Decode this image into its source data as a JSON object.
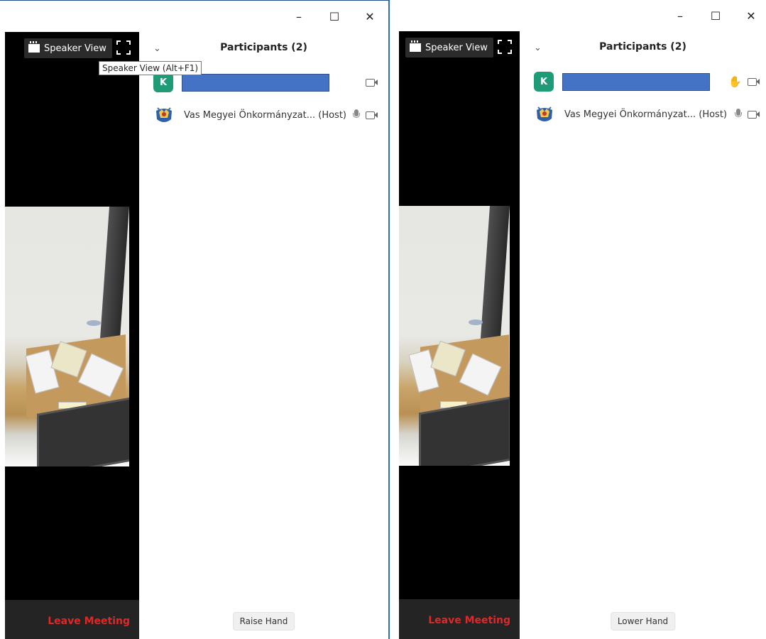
{
  "window_controls": {
    "minimize": "–",
    "maximize": "☐",
    "close": "✕"
  },
  "left": {
    "speaker_view_label": "Speaker View",
    "tooltip": "Speaker View (Alt+F1)",
    "participants_title": "Participants (2)",
    "participants": [
      {
        "avatar_letter": "K",
        "name": "",
        "icons": [
          "video-off-icon"
        ]
      },
      {
        "name": "Vas Megyei Önkormányzat... (Host)",
        "icons": [
          "mic-icon",
          "video-off-icon"
        ]
      }
    ],
    "leave_label": "Leave Meeting",
    "hand_button": "Raise Hand"
  },
  "right": {
    "speaker_view_label": "Speaker View",
    "participants_title": "Participants (2)",
    "participants": [
      {
        "avatar_letter": "K",
        "name": "",
        "icons": [
          "raised-hand-icon",
          "video-off-icon"
        ]
      },
      {
        "name": "Vas Megyei Önkormányzat... (Host)",
        "icons": [
          "mic-icon",
          "video-off-icon"
        ]
      }
    ],
    "leave_label": "Leave Meeting",
    "hand_button": "Lower Hand"
  },
  "colors": {
    "leave": "#e02828",
    "avatar": "#1f9b78",
    "raised_hand": "#2d7ce6",
    "redaction": "#4472c4"
  }
}
